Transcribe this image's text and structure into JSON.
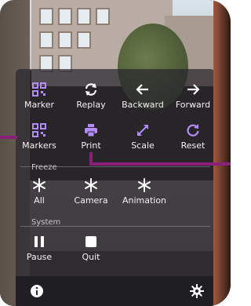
{
  "colors": {
    "accent": "#b48cff",
    "label": "#f2f2f2",
    "section": "#c8c8cc",
    "callout": "#8a1f7a"
  },
  "row1": [
    {
      "label": "Marker",
      "icon": "qr-marker-icon"
    },
    {
      "label": "Replay",
      "icon": "replay-icon"
    },
    {
      "label": "Backward",
      "icon": "arrow-left-icon"
    },
    {
      "label": "Forward",
      "icon": "arrow-right-icon"
    }
  ],
  "row2": [
    {
      "label": "Markers",
      "icon": "qr-markers-icon"
    },
    {
      "label": "Print",
      "icon": "printer-icon"
    },
    {
      "label": "Scale",
      "icon": "scale-icon"
    },
    {
      "label": "Reset",
      "icon": "reset-icon"
    }
  ],
  "freeze": {
    "title": "Freeze",
    "items": [
      {
        "label": "All",
        "icon": "snowflake-icon"
      },
      {
        "label": "Camera",
        "icon": "snowflake-icon"
      },
      {
        "label": "Animation",
        "icon": "snowflake-icon"
      }
    ]
  },
  "system": {
    "title": "System",
    "items": [
      {
        "label": "Pause",
        "icon": "pause-icon"
      },
      {
        "label": "Quit",
        "icon": "stop-icon"
      }
    ]
  },
  "bottom_bar": {
    "left_icon": "info-icon",
    "right_icon": "settings-icon"
  }
}
